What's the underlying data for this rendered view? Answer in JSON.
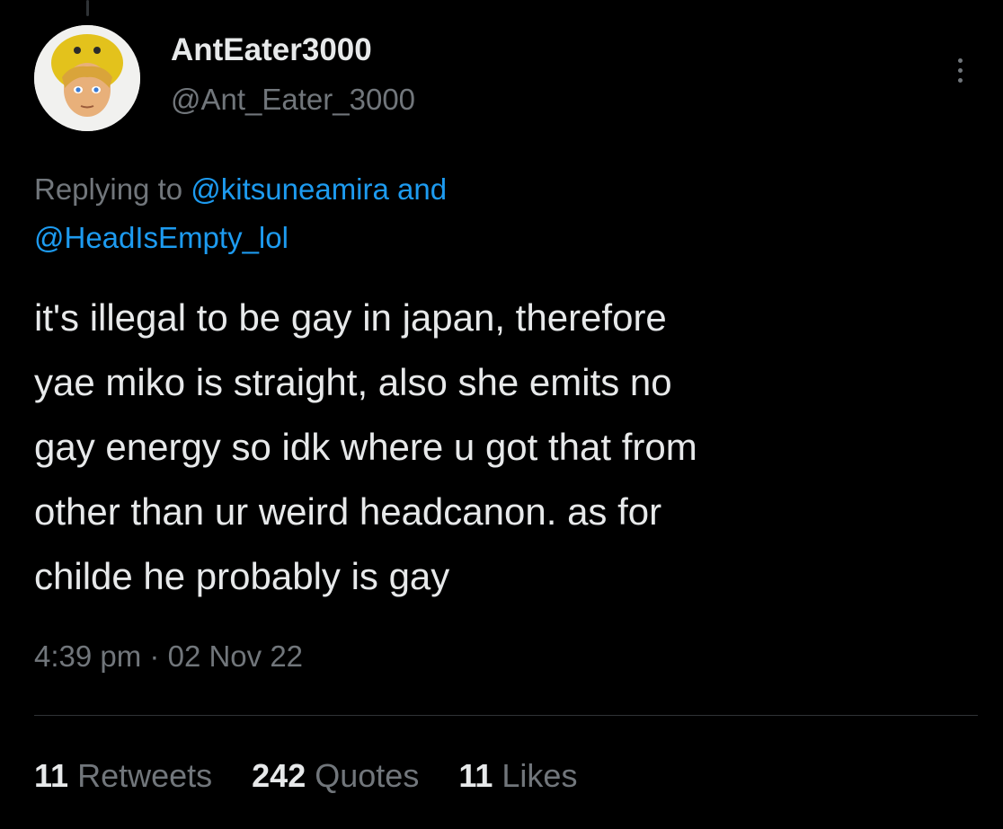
{
  "author": {
    "display_name": "AntEater3000",
    "handle": "@Ant_Eater_3000",
    "avatar_icon": "avatar-duck-hat-icon"
  },
  "reply": {
    "prefix": "Replying to",
    "user1": "@kitsuneamira",
    "and": "and",
    "user2": "@HeadIsEmpty_lol"
  },
  "tweet": {
    "lines": [
      "it's illegal to be gay in japan, therefore",
      "yae miko is straight, also she emits no",
      "gay energy so idk where u got that from",
      "other than ur weird headcanon. as for",
      "childe he probably is gay"
    ],
    "time": "4:39 pm",
    "separator": "·",
    "date": "02 Nov 22"
  },
  "stats": {
    "retweets_count": "11",
    "retweets_label": "Retweets",
    "quotes_count": "242",
    "quotes_label": "Quotes",
    "likes_count": "11",
    "likes_label": "Likes"
  },
  "colors": {
    "background": "#000000",
    "text": "#e7e9ea",
    "muted": "#71767b",
    "link": "#1d9bf0",
    "divider": "#2f3336"
  },
  "icons": {
    "more": "more-options-icon"
  }
}
